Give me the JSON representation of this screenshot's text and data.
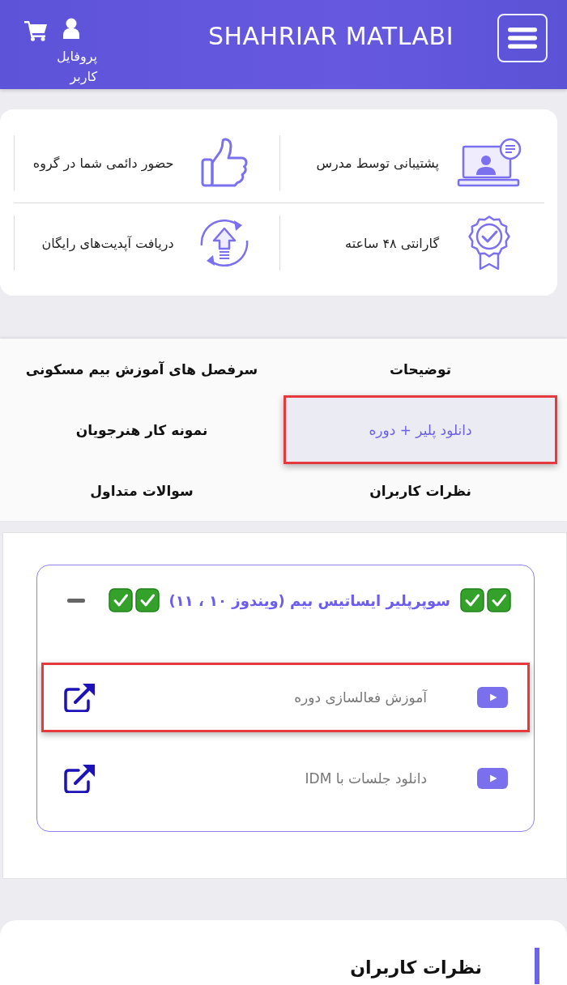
{
  "header": {
    "logo": "SHAHRIAR MATLABI",
    "profile_label": "پروفایل کاربر"
  },
  "features": [
    {
      "kind": "teacher_support",
      "label": "پشتیبانی توسط مدرس"
    },
    {
      "kind": "group_presence",
      "label": "حضور دائمی شما در گروه"
    },
    {
      "kind": "guarantee",
      "label": "گارانتی ۴۸ ساعته"
    },
    {
      "kind": "free_updates",
      "label": "دریافت آپدیت‌های رایگان"
    }
  ],
  "tabs": [
    {
      "label": "توضیحات",
      "selected": false,
      "highlighted": false
    },
    {
      "label": "سرفصل های آموزش بیم مسکونی",
      "selected": false,
      "highlighted": false
    },
    {
      "label": "دانلود پلیر + دوره",
      "selected": true,
      "highlighted": true
    },
    {
      "label": "نمونه کار هنرجویان",
      "selected": false,
      "highlighted": false
    },
    {
      "label": "نظرات کاربران",
      "selected": false,
      "highlighted": false
    },
    {
      "label": "سوالات متداول",
      "selected": false,
      "highlighted": false
    }
  ],
  "course_section": {
    "title": "سوپرپلیر ایساتیس بیم (ویندوز ۱۰ ، ۱۱)",
    "expanded": true,
    "items": [
      {
        "label": "آموزش فعالسازی دوره",
        "highlighted": true
      },
      {
        "label": "دانلود جلسات با IDM",
        "highlighted": false
      }
    ]
  },
  "reviews": {
    "heading": "نظرات کاربران"
  }
}
